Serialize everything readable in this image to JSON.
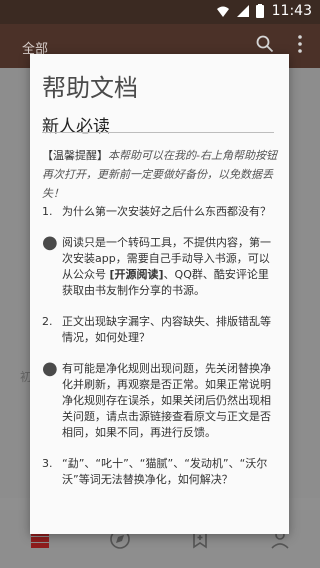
{
  "status": {
    "time": "11:43"
  },
  "appbar": {
    "title": "全部"
  },
  "background": {
    "fragment": "初"
  },
  "dialog": {
    "title": "帮助文档",
    "section": "新人必读",
    "intro_label": "【温馨提醒】",
    "intro_text": "本帮助可以在我的-右上角帮助按钮再次打开，更新前一定要做好备份，以免数据丢失！",
    "items": [
      {
        "marker": "1.",
        "text": "为什么第一次安装好之后什么东西都没有？"
      },
      {
        "marker": "●",
        "text_before": "阅读只是一个转码工具，不提供内容，第一次安装app，需要自己手动导入书源，可以从公众号 ",
        "bold": "[开源阅读]",
        "text_after": "、QQ群、酷安评论里获取由书友制作分享的书源。"
      },
      {
        "marker": "2.",
        "text": "正文出现缺字漏字、内容缺失、排版错乱等情况，如何处理？"
      },
      {
        "marker": "●",
        "text": "有可能是净化规则出现问题，先关闭替换净化并刷新，再观察是否正常。如果正常说明净化规则存在误杀，如果关闭后仍然出现相关问题，请点击源链接查看原文与正文是否相同，如果不同，再进行反馈。"
      },
      {
        "marker": "3.",
        "text": "“勐”、“叱十”、“猫腻”、“发动机”、“沃尔沃”等词无法替换净化，如何解决？"
      }
    ]
  }
}
